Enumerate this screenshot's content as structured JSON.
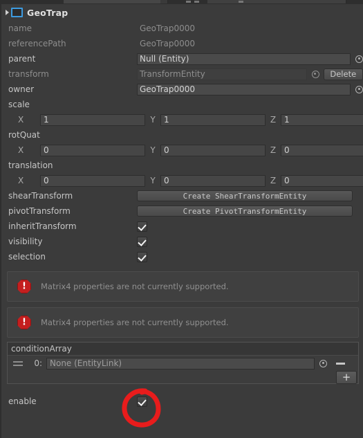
{
  "header": {
    "title": "GeoTrap",
    "expand_icon": "triangle-right-icon",
    "entity_icon": "entity-box-icon"
  },
  "properties": {
    "name": {
      "label": "name",
      "value": "GeoTrap0000",
      "enabled": false
    },
    "referencePath": {
      "label": "referencePath",
      "value": "GeoTrap0000",
      "enabled": false
    },
    "parent": {
      "label": "parent",
      "value": "Null (Entity)",
      "enabled": true,
      "picker_icon": "target-picker-icon"
    },
    "transform": {
      "label": "transform",
      "value": "TransformEntity",
      "enabled": false,
      "picker_icon": "target-picker-icon",
      "delete_label": "Delete"
    },
    "owner": {
      "label": "owner",
      "value": "GeoTrap0000",
      "enabled": true,
      "picker_icon": "target-picker-icon"
    }
  },
  "vectors": [
    {
      "label": "scale",
      "axes": [
        "X",
        "Y",
        "Z"
      ],
      "values": [
        "1",
        "1",
        "1"
      ]
    },
    {
      "label": "rotQuat",
      "axes": [
        "X",
        "Y",
        "Z"
      ],
      "values": [
        "0",
        "0",
        "0"
      ]
    },
    {
      "label": "translation",
      "axes": [
        "X",
        "Y",
        "Z"
      ],
      "values": [
        "0",
        "0",
        "0"
      ]
    }
  ],
  "actions": [
    {
      "label": "shearTransform",
      "button": "Create ShearTransformEntity"
    },
    {
      "label": "pivotTransform",
      "button": "Create PivotTransformEntity"
    }
  ],
  "toggles": [
    {
      "label": "inheritTransform",
      "checked": true
    },
    {
      "label": "visibility",
      "checked": true
    },
    {
      "label": "selection",
      "checked": true
    }
  ],
  "errors": [
    {
      "icon": "error-octagon-icon",
      "text": "Matrix4 properties are not currently supported."
    },
    {
      "icon": "error-octagon-icon",
      "text": "Matrix4 properties are not currently supported."
    }
  ],
  "array": {
    "title": "conditionArray",
    "rows": [
      {
        "index": "0:",
        "value": "None (EntityLink)",
        "grip_icon": "drag-handle-icon",
        "picker_icon": "target-picker-icon",
        "remove_label": "remove-row"
      }
    ],
    "add_label": "+"
  },
  "enable": {
    "label": "enable",
    "checked": true
  },
  "annotation": {
    "shape": "hand-drawn-circle",
    "color": "#e81c1c"
  }
}
